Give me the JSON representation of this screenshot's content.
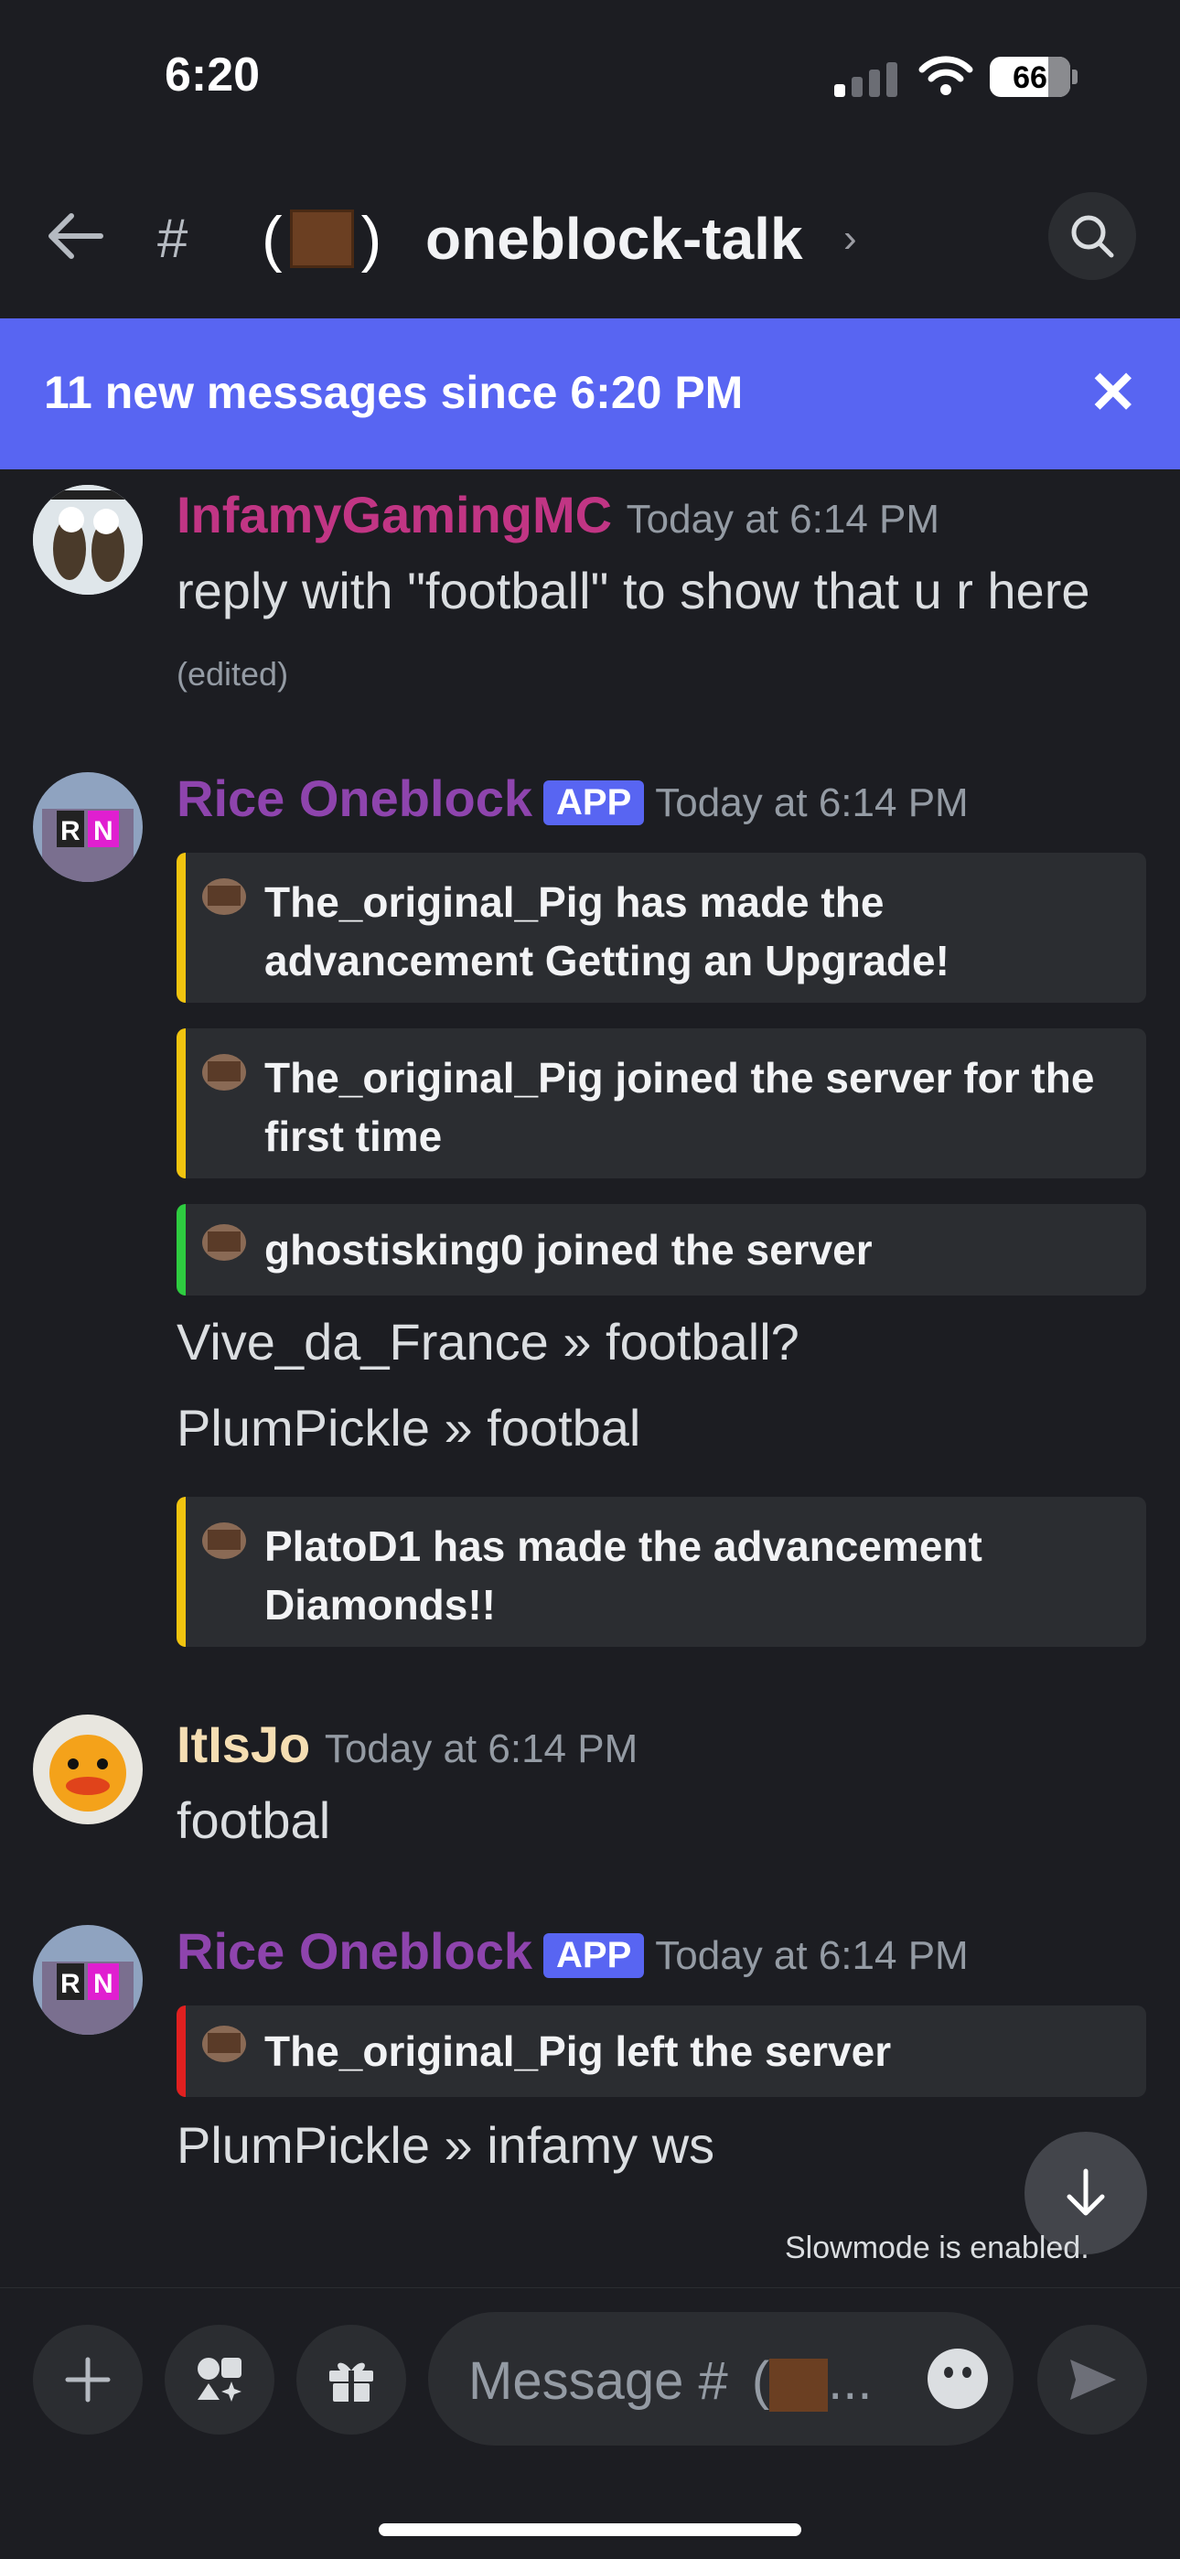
{
  "status": {
    "time": "6:20",
    "battery": "66"
  },
  "header": {
    "channel_name": "oneblock-talk"
  },
  "banner": {
    "text": "11 new messages since 6:20 PM"
  },
  "messages": {
    "m1": {
      "author": "InfamyGamingMC",
      "author_color": "#c13584",
      "timestamp": "Today at 6:14 PM",
      "text": "reply with \"football\" to show that u r here",
      "edited": "(edited)"
    },
    "m2": {
      "author": "Rice Oneblock",
      "author_color": "#8e44ad",
      "badge": "APP",
      "timestamp": "Today at 6:14 PM",
      "embed1": "The_original_Pig has made the advancement Getting an Upgrade!",
      "embed2": "The_original_Pig joined the server for the first time",
      "embed3": "ghostisking0 joined the server",
      "line1": "Vive_da_France » football?",
      "line2": "PlumPickle » footbal",
      "embed4": "PlatoD1 has made the advancement Diamonds!!"
    },
    "m3": {
      "author": "ItIsJo",
      "author_color": "#f5deb3",
      "timestamp": "Today at 6:14 PM",
      "text": "footbal"
    },
    "m4": {
      "author": "Rice Oneblock",
      "author_color": "#8e44ad",
      "badge": "APP",
      "timestamp": "Today at 6:14 PM",
      "embed1": "The_original_Pig left the server",
      "line1": "PlumPickle »  infamy ws"
    }
  },
  "slowmode": "Slowmode is enabled.",
  "composer": {
    "placeholder": "Message #"
  },
  "colors": {
    "accent": "#5865f2",
    "embed_yellow": "#f1c40f",
    "embed_green": "#2ecc40",
    "embed_red": "#e02020"
  },
  "icons": [
    "back-arrow-icon",
    "hash-icon",
    "search-icon",
    "close-icon",
    "arrow-down-icon",
    "plus-icon",
    "apps-icon",
    "gift-icon",
    "emoji-icon",
    "send-icon"
  ]
}
